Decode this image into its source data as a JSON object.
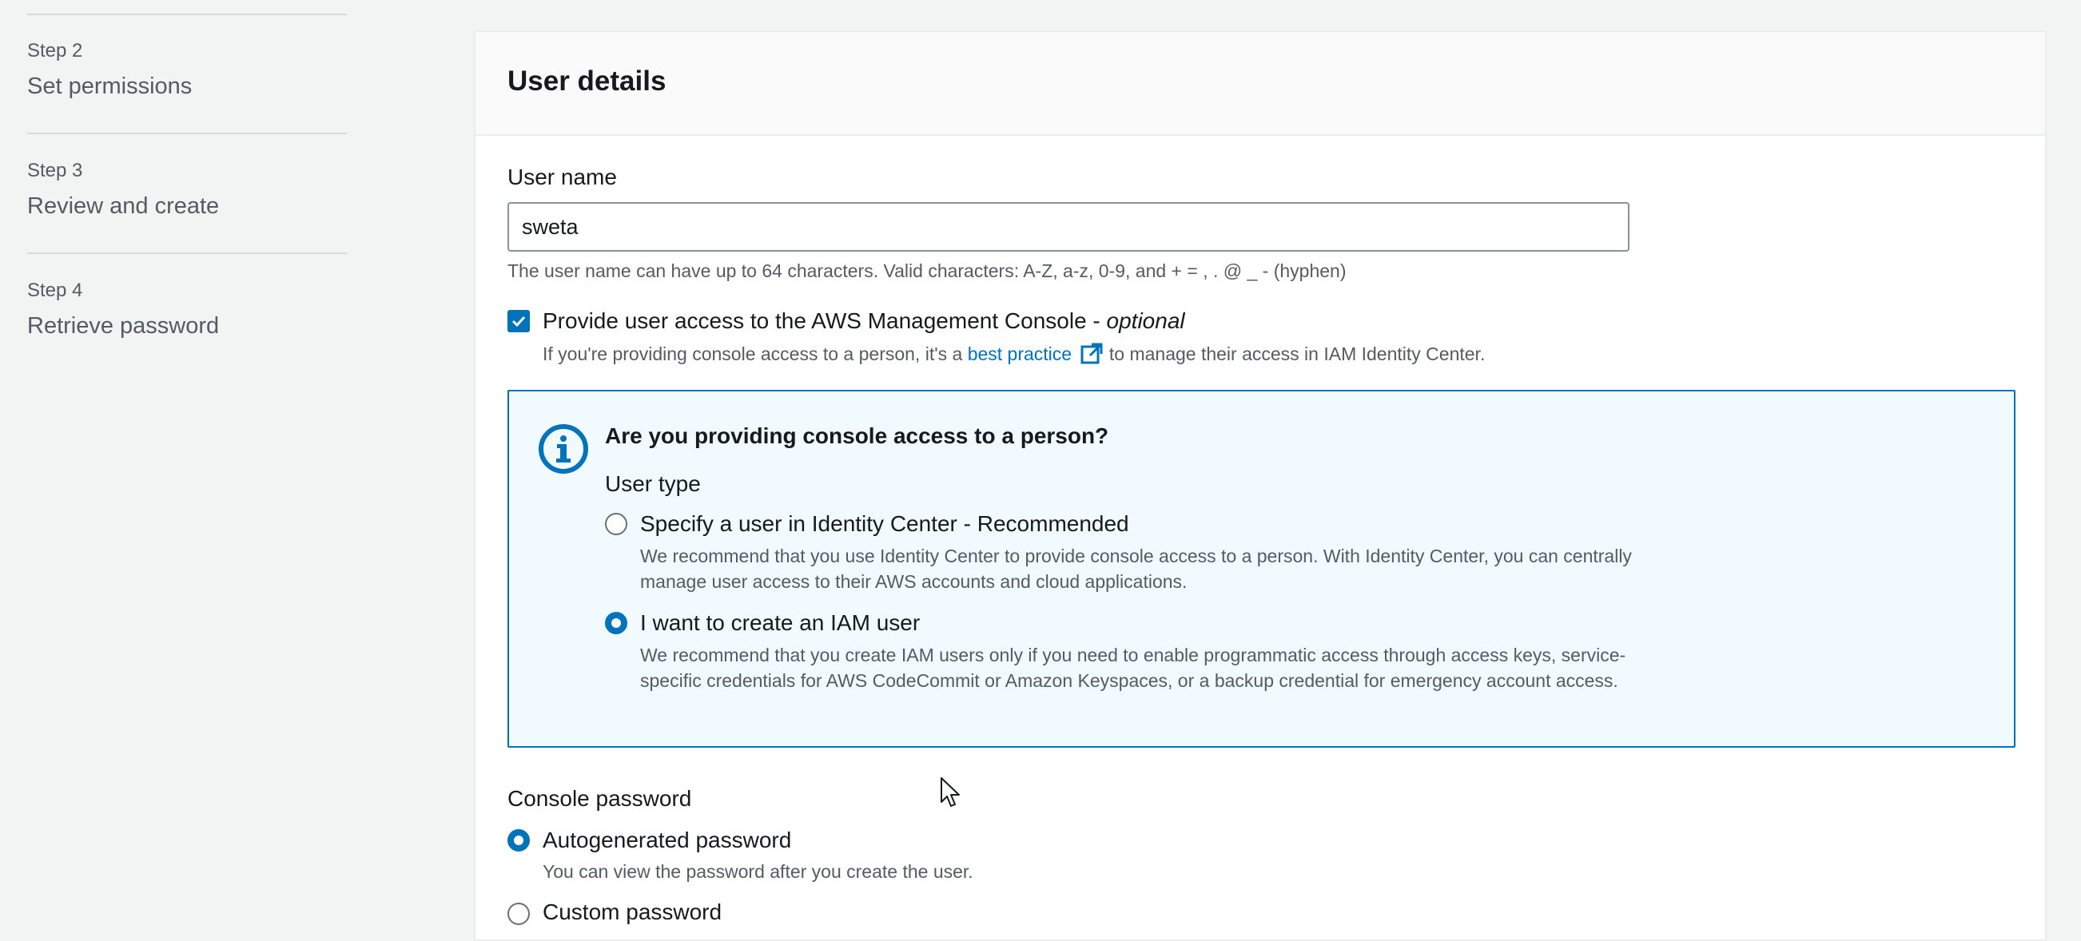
{
  "steps": [
    {
      "num": "Step 2",
      "title": "Set permissions"
    },
    {
      "num": "Step 3",
      "title": "Review and create"
    },
    {
      "num": "Step 4",
      "title": "Retrieve password"
    }
  ],
  "panel": {
    "title": "User details"
  },
  "user_name": {
    "label": "User name",
    "value": "sweta",
    "hint": "The user name can have up to 64 characters. Valid characters: A-Z, a-z, 0-9, and + = , . @ _ - (hyphen)"
  },
  "console_access": {
    "checked": true,
    "label": "Provide user access to the AWS Management Console - ",
    "optional": "optional",
    "hint_before": "If you're providing console access to a person, it's a ",
    "hint_link": "best practice",
    "hint_after": " to manage their access in IAM Identity Center."
  },
  "info": {
    "title": "Are you providing console access to a person?",
    "user_type_label": "User type",
    "options": [
      {
        "label": "Specify a user in Identity Center - Recommended",
        "desc": "We recommend that you use Identity Center to provide console access to a person. With Identity Center, you can centrally manage user access to their AWS accounts and cloud applications.",
        "selected": false
      },
      {
        "label": "I want to create an IAM user",
        "desc": "We recommend that you create IAM users only if you need to enable programmatic access through access keys, service-specific credentials for AWS CodeCommit or Amazon Keyspaces, or a backup credential for emergency account access.",
        "selected": true
      }
    ]
  },
  "console_password": {
    "label": "Console password",
    "options": [
      {
        "label": "Autogenerated password",
        "desc": "You can view the password after you create the user.",
        "selected": true
      },
      {
        "label": "Custom password",
        "selected": false
      }
    ]
  },
  "colors": {
    "accent": "#0073bb",
    "info_bg": "#f1faff",
    "page_bg": "#f2f3f3"
  },
  "icons": [
    "info-icon",
    "external-link-icon",
    "check-icon",
    "cursor-pointer-icon"
  ]
}
